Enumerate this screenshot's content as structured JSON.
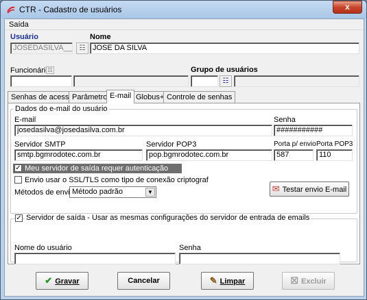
{
  "window": {
    "title": "CTR - Cadastro de usuários",
    "close_label": "x",
    "app_icon": "swirl-logo-icon"
  },
  "menu": {
    "items": [
      "Saída"
    ]
  },
  "header": {
    "usuario_label": "Usuário",
    "usuario_value": "JOSEDASILVA___",
    "nome_label": "Nome",
    "nome_value": "JOSE DA SILVA",
    "funcionario_label": "Funcionário",
    "grupo_label": "Grupo de usuários"
  },
  "tabs": [
    {
      "label": "Senhas de acesso",
      "active": false
    },
    {
      "label": "Parâmetros",
      "active": false
    },
    {
      "label": "E-mail",
      "active": true
    },
    {
      "label": "Globus+",
      "active": false
    },
    {
      "label": "Controle de senhas",
      "active": false
    }
  ],
  "email_tab": {
    "group_title": "Dados do e-mail do usuário",
    "email_label": "E-mail",
    "email_value": "josedasilva@josedasilva.com.br",
    "senha_label": "Senha",
    "senha_value": "###########",
    "smtp_label": "Servidor SMTP",
    "smtp_value": "smtp.bgmrodotec.com.br",
    "pop3_label": "Servidor POP3",
    "pop3_value": "pop.bgmrodotec.com.br",
    "porta_envio_label": "Porta p/ envio",
    "porta_envio_value": "587",
    "porta_pop3_label": "Porta POP3",
    "porta_pop3_value": "110",
    "auth_check_label": "Meu servidor de saída requer autenticação",
    "auth_checked": true,
    "ssl_check_label": "Envio usar o SSL/TLS como tipo de conexão criptograf",
    "ssl_checked": false,
    "metodos_label": "Métodos de envio",
    "metodos_value": "Método padrão",
    "testar_label": "Testar envio E-mail",
    "saida_group_check_label": "Servidor de saída - Usar as mesmas configurações do servidor de entrada de emails",
    "saida_checked": true,
    "nome_usuario_label": "Nome do usuário",
    "senha2_label": "Senha"
  },
  "buttons": {
    "gravar": "Gravar",
    "cancelar": "Cancelar",
    "limpar": "Limpar",
    "excluir": "Excluir"
  },
  "colors": {
    "accent_blue_label": "#1a2f9c",
    "highlight_row": "#6e6e6e",
    "close_red": "#c7452a"
  }
}
